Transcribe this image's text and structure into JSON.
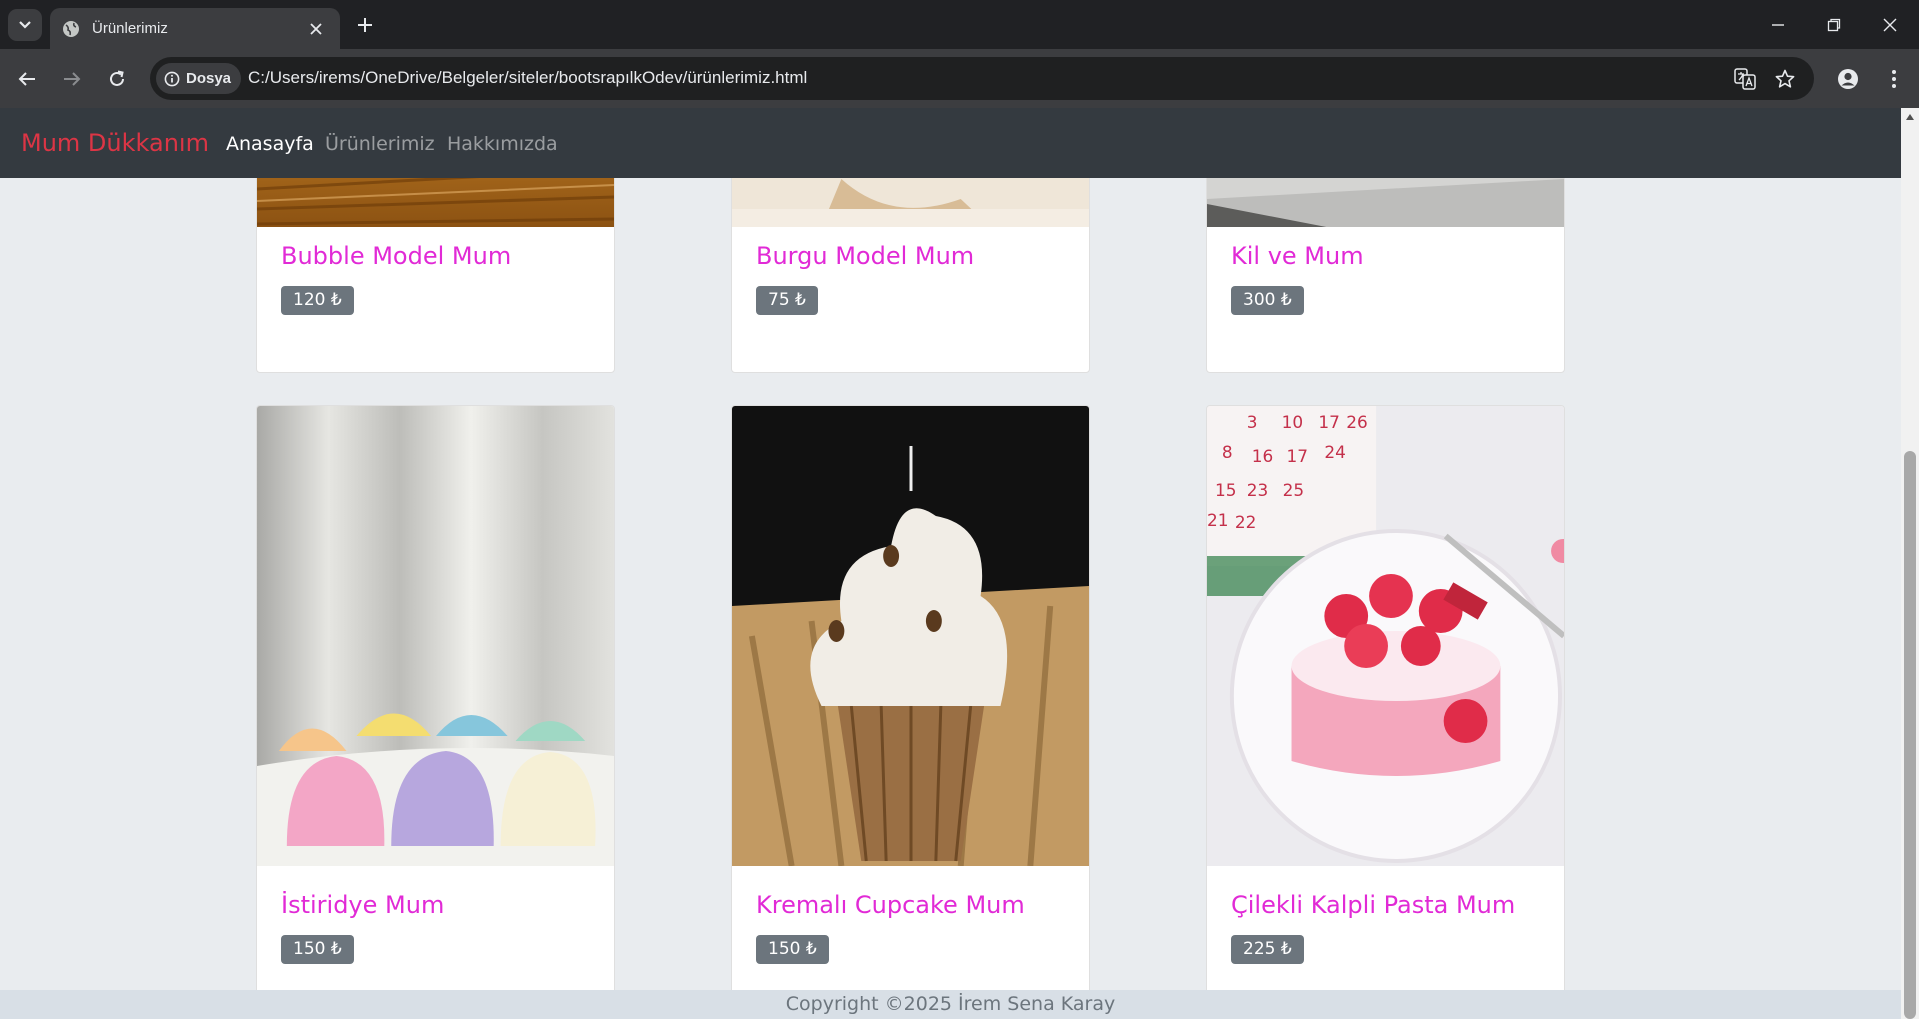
{
  "browser": {
    "tab_title": "Ürünlerimiz",
    "site_chip": "Dosya",
    "url": "C:/Users/irems/OneDrive/Belgeler/siteler/bootsrapılkOdev/ürünlerimiz.html"
  },
  "navbar": {
    "brand": "Mum Dükkanım",
    "links": [
      "Anasayfa",
      "Ürünlerimiz",
      "Hakkımızda"
    ]
  },
  "products": [
    {
      "name": "Bubble Model Mum",
      "price": "120 ₺"
    },
    {
      "name": "Burgu Model Mum",
      "price": "75 ₺"
    },
    {
      "name": "Kil ve Mum",
      "price": "300 ₺"
    },
    {
      "name": "İstiridye Mum",
      "price": "150 ₺"
    },
    {
      "name": "Kremalı Cupcake Mum",
      "price": "150 ₺"
    },
    {
      "name": "Çilekli Kalpli Pasta Mum",
      "price": "225 ₺"
    }
  ],
  "footer": {
    "copyright": "Copyright ©2025 İrem Sena Karay"
  }
}
